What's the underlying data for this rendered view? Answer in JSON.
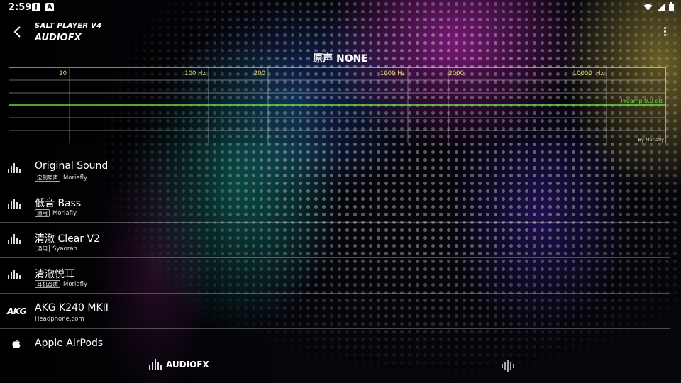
{
  "status_bar": {
    "time": "2:59",
    "left_icons": [
      "j-app-icon",
      "a-app-icon"
    ],
    "right_icons": [
      "wifi-icon",
      "signal-icon",
      "battery-icon"
    ]
  },
  "top_bar": {
    "app_name": "SALT PLAYER V4",
    "section": "AUDIOFX"
  },
  "preset_title": "原声 NONE",
  "eq": {
    "freq_labels": [
      "20",
      "100 Hz",
      "200",
      "1000 Hz",
      "2000",
      "10000  Hz"
    ],
    "preamp": "Preamp 0.0 dB",
    "author": "By Moriafly",
    "line_color": "#6fd64a",
    "label_color": "#e8d96a"
  },
  "presets": [
    {
      "name": "Original Sound",
      "tag": "定制原声",
      "author": "Moriafly",
      "icon": "equalizer-bars-icon"
    },
    {
      "name": "低音 Bass",
      "tag": "通用",
      "author": "Moriafly",
      "icon": "equalizer-bars-icon"
    },
    {
      "name": "清澈 Clear V2",
      "tag": "通用",
      "author": "Syaoran",
      "icon": "equalizer-bars-icon"
    },
    {
      "name": "清澈悦耳",
      "tag": "耳机音质",
      "author": "Moriafly",
      "icon": "equalizer-bars-icon"
    },
    {
      "name": "AKG K240 MKII",
      "tag": "",
      "author": "Headphone.com",
      "icon": "akg-logo-icon",
      "logo_text": "AKG"
    },
    {
      "name": "Apple AirPods",
      "tag": "",
      "author": "",
      "icon": "apple-logo-icon"
    }
  ],
  "bottom_nav": {
    "audiofx_label": "AUDIOFX"
  }
}
